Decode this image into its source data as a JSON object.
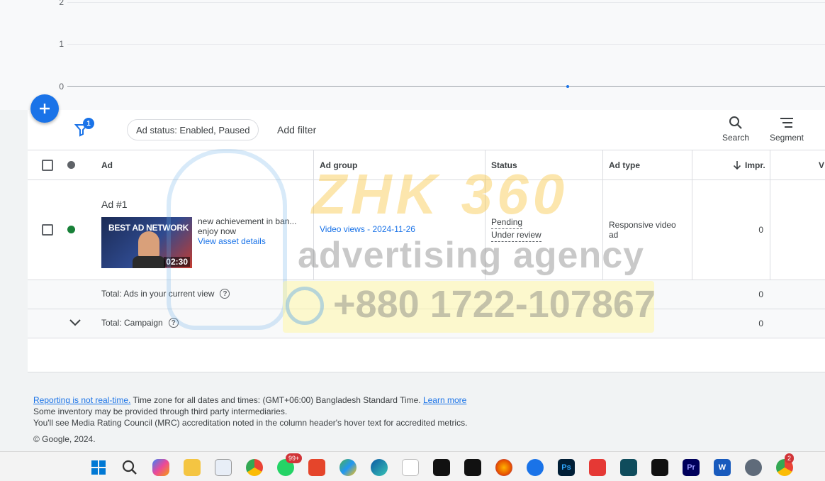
{
  "chart": {
    "y_ticks": [
      "2",
      "1",
      "0"
    ]
  },
  "filterbar": {
    "filter_badge": "1",
    "chip_label": "Ad status: Enabled, Paused",
    "add_filter": "Add filter",
    "search_label": "Search",
    "segment_label": "Segment"
  },
  "table": {
    "headers": {
      "ad": "Ad",
      "ad_group": "Ad group",
      "status": "Status",
      "ad_type": "Ad type",
      "impr": "Impr.",
      "next": "V"
    },
    "row": {
      "title": "Ad #1",
      "thumb_text": "BEST AD NETWORK",
      "thumb_duration": "02:30",
      "headline": "new achievement in ban...",
      "description": "enjoy now",
      "asset_link": "View asset details",
      "ad_group": "Video views - 2024-11-26",
      "status_1": "Pending",
      "status_2": "Under review",
      "ad_type": "Responsive video ad",
      "impr": "0"
    },
    "total_view": {
      "label": "Total: Ads in your current view",
      "impr": "0"
    },
    "total_campaign": {
      "label": "Total: Campaign",
      "impr": "0"
    }
  },
  "footer": {
    "reporting_link": "Reporting is not real-time.",
    "timezone": " Time zone for all dates and times: (GMT+06:00) Bangladesh Standard Time. ",
    "learn_more": "Learn more",
    "line2": "Some inventory may be provided through third party intermediaries.",
    "line3": "You'll see Media Rating Council (MRC) accreditation noted in the column header's hover text for accredited metrics.",
    "copyright": "© Google, 2024."
  },
  "watermark": {
    "title": "ZHK 360",
    "subtitle": "advertising agency",
    "phone": "+880 1722-107867"
  },
  "taskbar": {
    "whatsapp_badge": "99+",
    "chrome_badge": "2",
    "photoshop": "Ps",
    "premiere": "Pr",
    "word": "W"
  },
  "colors": {
    "accent": "#1a73e8",
    "enabled": "#188038",
    "paused": "#5f6368"
  }
}
